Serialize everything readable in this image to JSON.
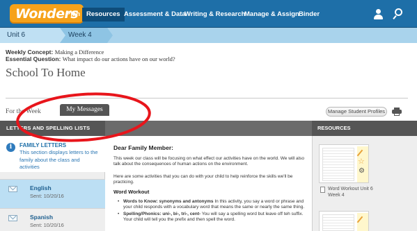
{
  "nav": {
    "logo": "Wonders",
    "items": [
      "Plan",
      "Resources",
      "Assessment & Data",
      "Writing & Research",
      "Manage & Assign",
      "Binder"
    ],
    "active": "Resources"
  },
  "breadcrumb": {
    "unit": "Unit 6",
    "week": "Week 4"
  },
  "header": {
    "concept_label": "Weekly Concept:",
    "concept_value": "Making a Difference",
    "question_label": "Essential Question:",
    "question_value": "What impact do our actions have on our world?",
    "title": "School To Home"
  },
  "subtabs": {
    "week": "For the Week",
    "messages": "My Messages"
  },
  "toolbar": {
    "profiles": "Manage Student Profiles"
  },
  "panels": {
    "left_header": "LETTERS AND SPELLING LISTS",
    "right_header": "RESOURCES"
  },
  "family_letters": {
    "title": "FAMILY LETTERS",
    "description": "This section displays letters to the family about the class and activities"
  },
  "letters": [
    {
      "name": "English",
      "sent": "Sent: 10/20/16"
    },
    {
      "name": "Spanish",
      "sent": "Sent: 10/20/16"
    }
  ],
  "letter": {
    "greeting": "Dear Family Member:",
    "p1": "This week our class will be focusing on what effect our activities have on the world. We will also talk about the consequences of human actions on the environment.",
    "p2": "Here are some activities that you can do with your child to help reinforce the skills we'll be practicing.",
    "workout_heading": "Word Workout",
    "b1_label": "Words to Know: synonyms and antonyms",
    "b1_text": " In this activity, you say a word or phrase and your child responds with a vocabulary word that means the same or nearly the same thing.",
    "b2_label": "Spelling/Phonics: uni-, bi-, tri-, cent-",
    "b2_text": " You will say a spelling word but leave off teh suffix. Your child will tell you the prefix and then spell the word."
  },
  "resources": [
    {
      "label": "Word Workout Unit 6 Week 4"
    }
  ],
  "colors": {
    "nav": "#1e6fa8",
    "logo": "#f6a21a",
    "band": "#555555",
    "selected": "#bcdff4",
    "annotation": "#e8151b"
  }
}
